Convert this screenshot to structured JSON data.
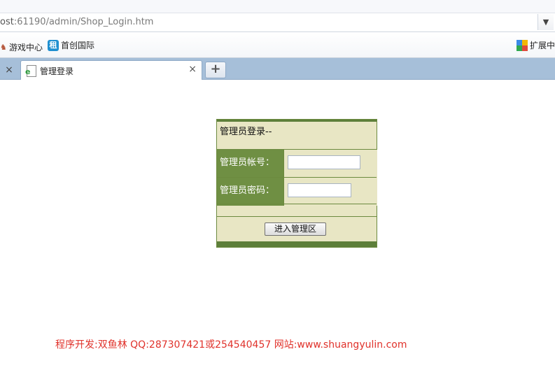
{
  "browser": {
    "address": {
      "host_fragment": "ost",
      "path": ":61190/admin/Shop_Login.htm"
    },
    "bookmarks": [
      {
        "label": "游戏中心",
        "icon": "game-icon"
      },
      {
        "label": "首创国际",
        "icon": "shou-icon",
        "icon_text": "租"
      }
    ],
    "extensions_label": "扩展中",
    "tabs": [
      {
        "title": "管理登录",
        "active": true
      }
    ],
    "new_tab_label": "+",
    "close_glyph": "×"
  },
  "login": {
    "title": "管理员登录--",
    "account_label": "管理员帐号：",
    "account_value": "",
    "password_label": "管理员密码：",
    "password_value": "",
    "submit_label": "进入管理区"
  },
  "footer": {
    "credit": "程序开发:双鱼林 QQ:287307421或254540457 网站:www.shuangyulin.com"
  },
  "colors": {
    "tab_bar": "#a6bfd9",
    "login_bg": "#e8e6c4",
    "label_bg": "#6f8f43",
    "border_green": "#5d7f3a",
    "credit_red": "#e0322b"
  }
}
